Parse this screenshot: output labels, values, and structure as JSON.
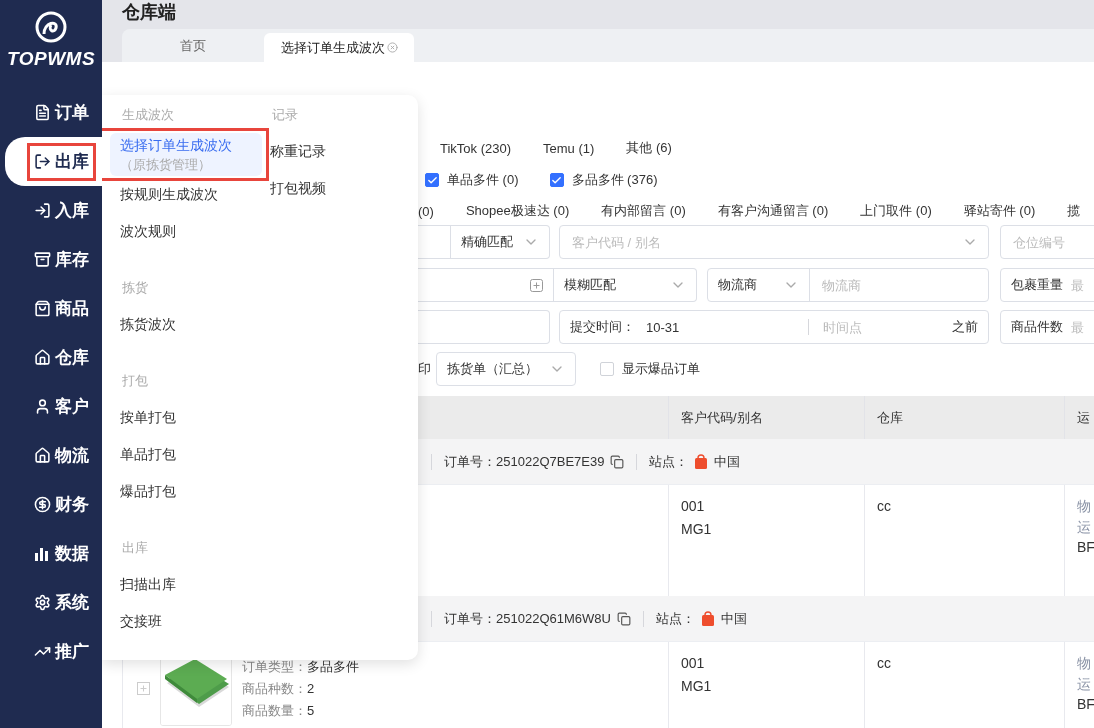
{
  "sidebar": {
    "logo": "TOPWMS",
    "items": [
      {
        "label": "订单",
        "selected": false,
        "highlighted": false
      },
      {
        "label": "出库",
        "selected": true,
        "highlighted": true
      },
      {
        "label": "入库",
        "selected": false,
        "highlighted": false
      },
      {
        "label": "库存",
        "selected": false,
        "highlighted": false
      },
      {
        "label": "商品",
        "selected": false,
        "highlighted": false
      },
      {
        "label": "仓库",
        "selected": false,
        "highlighted": false
      },
      {
        "label": "客户",
        "selected": false,
        "highlighted": false
      },
      {
        "label": "物流",
        "selected": false,
        "highlighted": false
      },
      {
        "label": "财务",
        "selected": false,
        "highlighted": false
      },
      {
        "label": "数据",
        "selected": false,
        "highlighted": false
      },
      {
        "label": "系统",
        "selected": false,
        "highlighted": false
      },
      {
        "label": "推广",
        "selected": false,
        "highlighted": false
      }
    ]
  },
  "header": {
    "title": "仓库端"
  },
  "tabs": [
    {
      "label": "首页",
      "selected": false
    },
    {
      "label": "选择订单生成波次",
      "selected": true
    }
  ],
  "menu": {
    "columns": [
      {
        "sections": [
          {
            "title": "生成波次",
            "items": [
              {
                "label": "选择订单生成波次",
                "sub": "（原拣货管理）",
                "selected": true,
                "highlighted": true
              },
              {
                "label": "按规则生成波次",
                "selected": false,
                "highlighted": false
              },
              {
                "label": "波次规则",
                "selected": false,
                "highlighted": false
              }
            ]
          },
          {
            "title": "拣货",
            "items": [
              {
                "label": "拣货波次",
                "selected": false,
                "highlighted": false
              }
            ]
          },
          {
            "title": "打包",
            "items": [
              {
                "label": "按单打包",
                "selected": false,
                "highlighted": false
              },
              {
                "label": "单品打包",
                "selected": false,
                "highlighted": false
              },
              {
                "label": "爆品打包",
                "selected": false,
                "highlighted": false
              }
            ]
          },
          {
            "title": "出库",
            "items": [
              {
                "label": "扫描出库",
                "selected": false,
                "highlighted": false
              },
              {
                "label": "交接班",
                "selected": false,
                "highlighted": false
              }
            ]
          }
        ]
      },
      {
        "sections": [
          {
            "title": "记录",
            "items": [
              {
                "label": "称重记录",
                "selected": false,
                "highlighted": false
              },
              {
                "label": "打包视频",
                "selected": false,
                "highlighted": false
              }
            ]
          }
        ]
      }
    ]
  },
  "platforms": [
    "TikTok (230)",
    "Temu (1)",
    "其他 (6)"
  ],
  "order_types": [
    {
      "label": "单品多件 (0)",
      "checked": true
    },
    {
      "label": "多品多件 (376)",
      "checked": true
    }
  ],
  "tags": [
    "(0)",
    "Shopee极速达 (0)",
    "有内部留言 (0)",
    "有客户沟通留言 (0)",
    "上门取件 (0)",
    "驿站寄件 (0)",
    "揽"
  ],
  "filters": {
    "match_select": "精确匹配",
    "customer_placeholder": "客户代码 / 别名",
    "bin_placeholder": "仓位编号",
    "fuzzy_select": "模糊匹配",
    "carrier_select": "物流商",
    "carrier_placeholder": "物流商",
    "weight_label": "包裹重量",
    "weight_placeholder": "最",
    "time_label": "提交时间：",
    "time_value": "10-31",
    "time_placeholder": "时间点",
    "time_suffix": "之前",
    "qty_label": "商品件数",
    "qty_placeholder": "最",
    "print_label": "印",
    "print_select": "拣货单（汇总）",
    "hot_label": "显示爆品订单",
    "hot_checked": false
  },
  "table": {
    "columns": [
      "客户代码/别名",
      "仓库",
      "运"
    ],
    "orders": [
      {
        "order_label": "订单号：",
        "order_no": "251022Q7BE7E39",
        "site_label": "站点：",
        "site": "中国",
        "customer": [
          "001",
          "MG1"
        ],
        "warehouse": "cc",
        "shipping": [
          "物",
          "运",
          "BF"
        ]
      },
      {
        "order_label": "订单号：",
        "order_no": "251022Q61M6W8U",
        "site_label": "站点：",
        "site": "中国",
        "customer": [
          "001",
          "MG1"
        ],
        "warehouse": "cc",
        "shipping": [
          "物",
          "运",
          "BF"
        ],
        "details": [
          {
            "label": "订单类型：",
            "value": "多品多件"
          },
          {
            "label": "商品种数：",
            "value": "2"
          },
          {
            "label": "商品数量：",
            "value": "5"
          }
        ]
      }
    ]
  }
}
